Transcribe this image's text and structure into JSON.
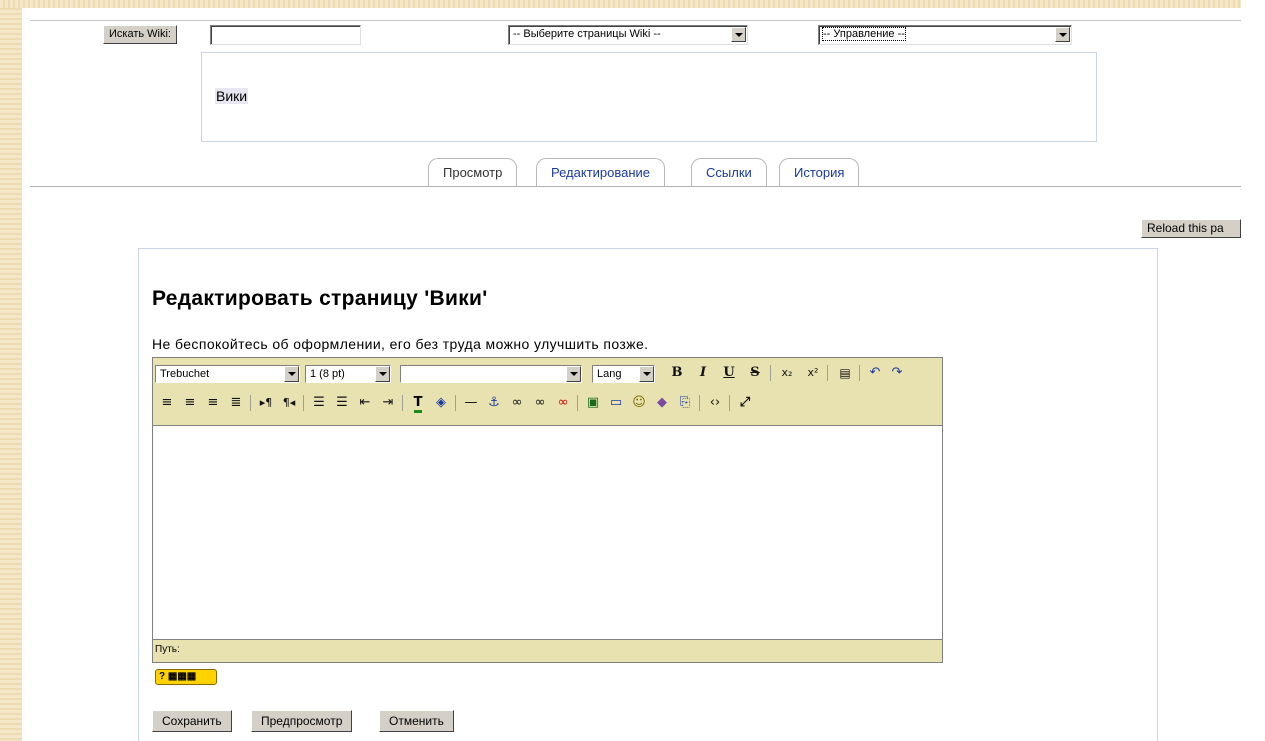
{
  "topbar": {
    "search_button": "Искать Wiki:",
    "search_value": "",
    "pages_select": "-- Выберите страницы Wiki --",
    "admin_select": "-- Управление --"
  },
  "wiki_title": "Вики",
  "tabs": [
    {
      "label": "Просмотр",
      "active": true
    },
    {
      "label": "Редактирование",
      "active": false
    },
    {
      "label": "Ссылки",
      "active": false
    },
    {
      "label": "История",
      "active": false
    }
  ],
  "reload_button": "Reload this pa",
  "heading": "Редактировать страницу 'Вики'",
  "hint": "Не беспокойтесь об оформлении, его без труда можно улучшить позже.",
  "editor": {
    "font_select": "Trebuchet",
    "size_select": "1 (8 pt)",
    "format_select": "",
    "lang_select": "Lang",
    "path_label": "Путь:",
    "content": ""
  },
  "buttons": {
    "save": "Сохранить",
    "preview": "Предпросмотр",
    "cancel": "Отменить"
  },
  "colors": {
    "toolbar_bg": "#e8e2b0",
    "link": "#1a3aa0",
    "help_badge": "#ffd200"
  }
}
